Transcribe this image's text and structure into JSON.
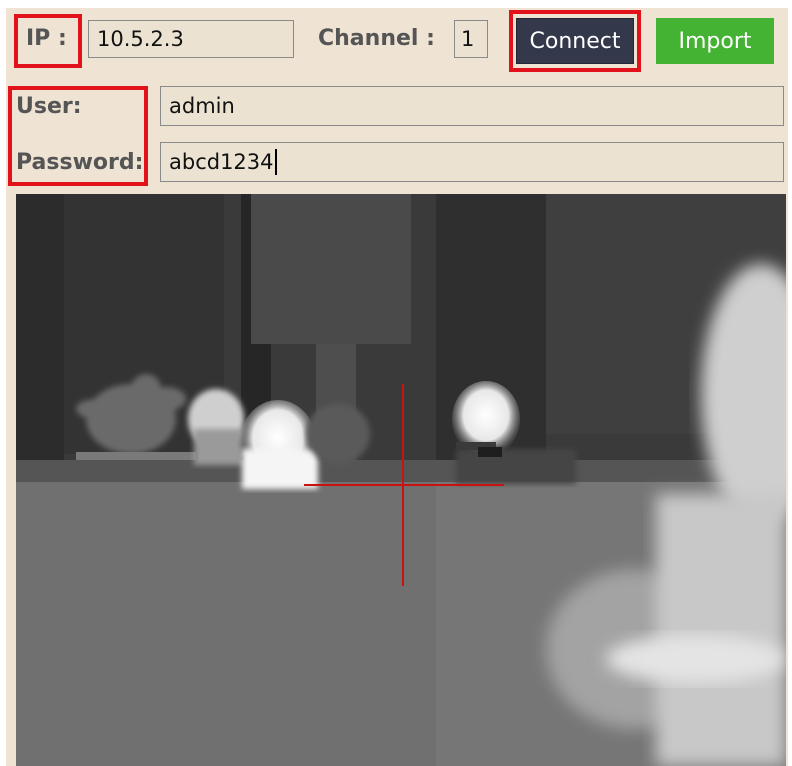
{
  "connection": {
    "ip_label": "IP :",
    "ip_value": "10.5.2.3",
    "channel_label": "Channel :",
    "channel_value": "1",
    "connect_label": "Connect",
    "import_label": "Import"
  },
  "credentials": {
    "user_label": "User:",
    "user_value": "admin",
    "password_label": "Password:",
    "password_value": "abcd1234"
  },
  "colors": {
    "panel_bg": "#efe4d4",
    "connect_bg": "#33394a",
    "import_bg": "#44b232",
    "highlight": "#e2121a",
    "crosshair": "#cc1111"
  },
  "video": {
    "mode": "thermal-grayscale",
    "crosshair": true
  }
}
